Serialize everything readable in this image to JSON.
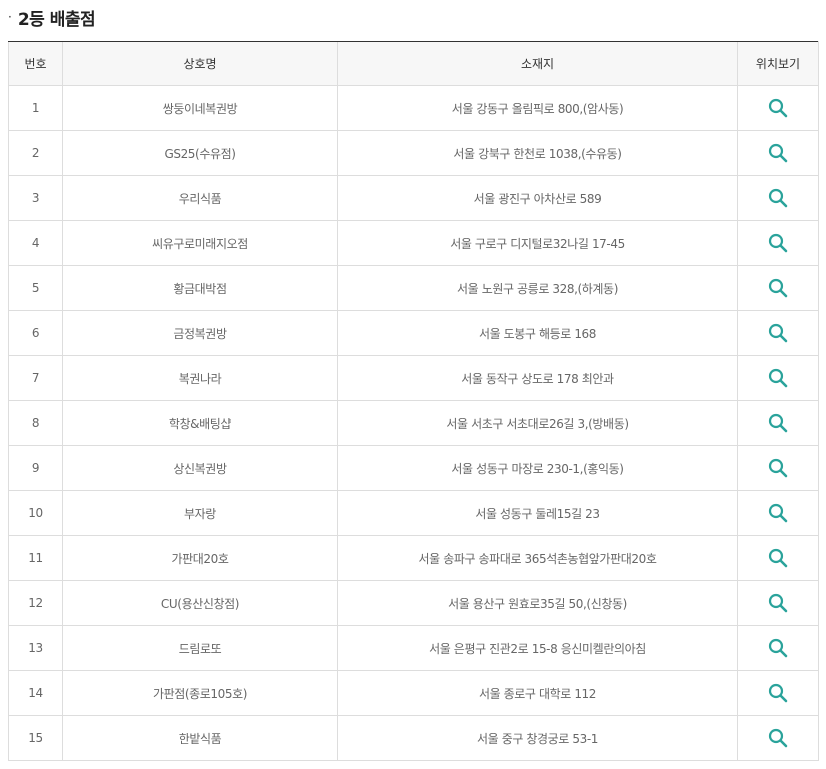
{
  "section": {
    "bullet": "·",
    "title": "2등 배출점"
  },
  "table": {
    "headers": {
      "no": "번호",
      "name": "상호명",
      "address": "소재지",
      "location": "위치보기"
    },
    "rows": [
      {
        "no": "1",
        "name": "쌍둥이네복권방",
        "address": "서울 강동구 올림픽로 800,(암사동)"
      },
      {
        "no": "2",
        "name": "GS25(수유점)",
        "address": "서울 강북구 한천로 1038,(수유동)"
      },
      {
        "no": "3",
        "name": "우리식품",
        "address": "서울 광진구 아차산로 589"
      },
      {
        "no": "4",
        "name": "씨유구로미래지오점",
        "address": "서울 구로구 디지털로32나길 17-45"
      },
      {
        "no": "5",
        "name": "황금대박점",
        "address": "서울 노원구 공릉로 328,(하계동)"
      },
      {
        "no": "6",
        "name": "금정복권방",
        "address": "서울 도봉구 해등로 168"
      },
      {
        "no": "7",
        "name": "복권나라",
        "address": "서울 동작구 상도로 178 최안과"
      },
      {
        "no": "8",
        "name": "학창&배팅샵",
        "address": "서울 서초구 서초대로26길 3,(방배동)"
      },
      {
        "no": "9",
        "name": "상신복권방",
        "address": "서울 성동구 마장로 230-1,(홍익동)"
      },
      {
        "no": "10",
        "name": "부자랑",
        "address": "서울 성동구 둘레15길 23"
      },
      {
        "no": "11",
        "name": "가판대20호",
        "address": "서울 송파구 송파대로 365석촌농협앞가판대20호"
      },
      {
        "no": "12",
        "name": "CU(용산신창점)",
        "address": "서울 용산구 원효로35길 50,(신창동)"
      },
      {
        "no": "13",
        "name": "드림로또",
        "address": "서울 은평구 진관2로 15-8 응신미켈란의아침"
      },
      {
        "no": "14",
        "name": "가판점(종로105호)",
        "address": "서울 종로구 대학로 112"
      },
      {
        "no": "15",
        "name": "한밭식품",
        "address": "서울 중구 창경궁로 53-1"
      }
    ]
  },
  "icons": {
    "location": "search-icon",
    "color": "#2aa39b"
  }
}
